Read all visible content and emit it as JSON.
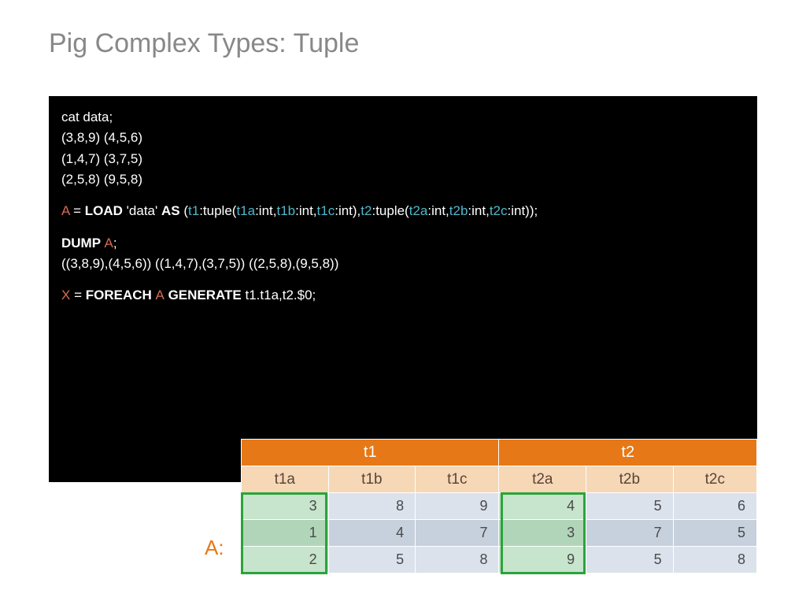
{
  "title": "Pig Complex Types: Tuple",
  "code": {
    "l1": "cat data;",
    "l2": "(3,8,9) (4,5,6)",
    "l3": "(1,4,7) (3,7,5)",
    "l4": "(2,5,8) (9,5,8)",
    "load": {
      "a": "A",
      "eq": " = ",
      "load": "LOAD",
      "data": " 'data' ",
      "as": "AS",
      "p1": " (",
      "t1": "t1",
      "p2": ":tuple(",
      "t1a": "t1a",
      "int1": ":int,",
      "t1b": "t1b",
      "int2": ":int,",
      "t1c": "t1c",
      "int3": ":int),",
      "t2": "t2",
      "p3": ":tuple(",
      "t2a": "t2a",
      "int4": ":int,",
      "t2b": "t2b",
      "int5": ":int,",
      "t2c": "t2c",
      "int6": ":int));"
    },
    "dump": {
      "d": "DUMP ",
      "a": "A",
      "semi": ";"
    },
    "l6": "((3,8,9),(4,5,6)) ((1,4,7),(3,7,5)) ((2,5,8),(9,5,8))",
    "foreach": {
      "x": "X",
      "eq": " = ",
      "fe": "FOREACH ",
      "a": "A",
      "gen": " GENERATE ",
      "rest": "t1.t1a,t2.$0;"
    }
  },
  "a_label": "A:",
  "table": {
    "h1": "t1",
    "h2": "t2",
    "sub": [
      "t1a",
      "t1b",
      "t1c",
      "t2a",
      "t2b",
      "t2c"
    ],
    "rows": [
      [
        "3",
        "8",
        "9",
        "4",
        "5",
        "6"
      ],
      [
        "1",
        "4",
        "7",
        "3",
        "7",
        "5"
      ],
      [
        "2",
        "5",
        "8",
        "9",
        "5",
        "8"
      ]
    ]
  }
}
